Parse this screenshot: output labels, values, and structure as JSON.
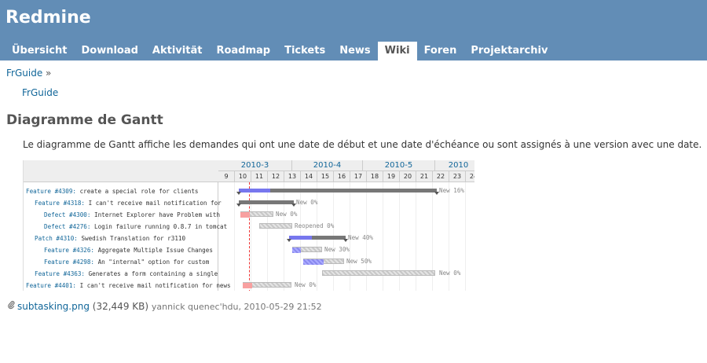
{
  "app": {
    "title": "Redmine"
  },
  "menu": {
    "tabs": [
      {
        "label": "Übersicht"
      },
      {
        "label": "Download"
      },
      {
        "label": "Aktivität"
      },
      {
        "label": "Roadmap"
      },
      {
        "label": "Tickets"
      },
      {
        "label": "News"
      },
      {
        "label": "Wiki",
        "active": true
      },
      {
        "label": "Foren"
      },
      {
        "label": "Projektarchiv"
      }
    ]
  },
  "breadcrumb": {
    "link": "FrGuide",
    "sep": "»"
  },
  "toc": {
    "link": "FrGuide"
  },
  "page": {
    "title": "Diagramme de Gantt",
    "description": "Le diagramme de Gantt affiche les demandes qui ont une date de début et une date d'échéance ou sont assignés à une version avec une date."
  },
  "gantt": {
    "months": [
      "2010-3",
      "2010-4",
      "2010-5",
      "2010"
    ],
    "days": [
      "9",
      "10",
      "11",
      "12",
      "13",
      "14",
      "15",
      "16",
      "17",
      "18",
      "19",
      "20",
      "21",
      "22",
      "23",
      "24"
    ],
    "rows": [
      {
        "tracker": "Feature #4309:",
        "subject": " create a special role for clients",
        "status": "New 16%",
        "done": 0.16
      },
      {
        "tracker": "Feature #4318:",
        "subject": " I can't receive mail notification for",
        "status": "New 0%",
        "done": 0
      },
      {
        "tracker": "Defect #4300:",
        "subject": " Internet Explorer have Problem with",
        "status": "New 0%",
        "done": 0
      },
      {
        "tracker": "Defect #4276:",
        "subject": " Login failure running 0.8.7 in tomcat",
        "status": "Reopened 0%",
        "done": 0
      },
      {
        "tracker": "Patch #4310:",
        "subject": " Swedish Translation for r3110",
        "status": "New 40%",
        "done": 0.4
      },
      {
        "tracker": "Feature #4326:",
        "subject": " Aggregate Multiple Issue Changes",
        "status": "New 30%",
        "done": 0.3
      },
      {
        "tracker": "Feature #4298:",
        "subject": " An \"internal\" option for custom",
        "status": "New 50%",
        "done": 0.5
      },
      {
        "tracker": "Feature #4363:",
        "subject": " Generates a form containing a single",
        "status": "New 0%",
        "done": 0
      },
      {
        "tracker": "Feature #4401:",
        "subject": " I can't receive mail notification for news",
        "status": "New 0%",
        "done": 0
      }
    ]
  },
  "attachment": {
    "filename": "subtasking.png",
    "size": "(32,449 KB)",
    "author_date": "yannick quenec'hdu, 2010-05-29 21:52"
  }
}
